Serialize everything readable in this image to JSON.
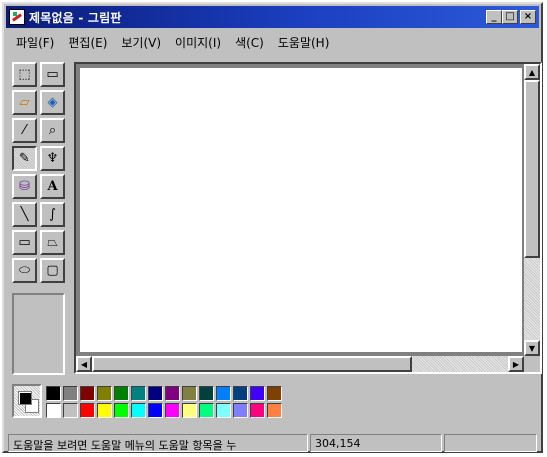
{
  "window": {
    "title": "제목없음 - 그림판",
    "minimize_label": "_",
    "maximize_label": "□",
    "close_label": "×"
  },
  "menu": [
    {
      "label": "파일(F)"
    },
    {
      "label": "편집(E)"
    },
    {
      "label": "보기(V)"
    },
    {
      "label": "이미지(I)"
    },
    {
      "label": "색(C)"
    },
    {
      "label": "도움말(H)"
    }
  ],
  "tools": [
    {
      "name": "free-form-select-icon",
      "glyph": "⬚"
    },
    {
      "name": "select-icon",
      "glyph": "▭"
    },
    {
      "name": "eraser-icon",
      "glyph": "▱"
    },
    {
      "name": "fill-icon",
      "glyph": "◈"
    },
    {
      "name": "color-picker-icon",
      "glyph": "⁄"
    },
    {
      "name": "magnifier-icon",
      "glyph": "⌕"
    },
    {
      "name": "pencil-icon",
      "glyph": "✎",
      "active": true
    },
    {
      "name": "brush-icon",
      "glyph": "♆"
    },
    {
      "name": "airbrush-icon",
      "glyph": "⛁"
    },
    {
      "name": "text-icon",
      "glyph": "A"
    },
    {
      "name": "line-icon",
      "glyph": "╲"
    },
    {
      "name": "curve-icon",
      "glyph": "∫"
    },
    {
      "name": "rectangle-icon",
      "glyph": "▭"
    },
    {
      "name": "polygon-icon",
      "glyph": "⏢"
    },
    {
      "name": "ellipse-icon",
      "glyph": "⬭"
    },
    {
      "name": "rounded-rectangle-icon",
      "glyph": "▢"
    }
  ],
  "colors": {
    "foreground": "#000000",
    "background": "#ffffff",
    "palette_top": [
      "#000000",
      "#808080",
      "#800000",
      "#808000",
      "#008000",
      "#008080",
      "#000080",
      "#800080",
      "#808040",
      "#004040",
      "#0080ff",
      "#004080",
      "#4000ff",
      "#804000"
    ],
    "palette_bottom": [
      "#ffffff",
      "#c0c0c0",
      "#ff0000",
      "#ffff00",
      "#00ff00",
      "#00ffff",
      "#0000ff",
      "#ff00ff",
      "#ffff80",
      "#00ff80",
      "#80ffff",
      "#8080ff",
      "#ff0080",
      "#ff8040"
    ]
  },
  "status": {
    "help_text": "도움말을 보려면 도움말 메뉴의 도움말 항목을 누",
    "coordinates": "304,154",
    "size": ""
  }
}
